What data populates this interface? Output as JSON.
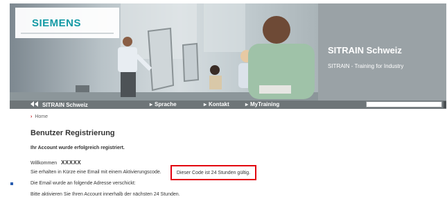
{
  "header": {
    "logo_text": "SIEMENS",
    "side_title": "SITRAIN Schweiz",
    "side_subtitle": "SITRAIN - Training for Industry"
  },
  "nav": {
    "brand": "SITRAIN Schweiz",
    "brand_icon": "double-chevron-icon",
    "items": [
      {
        "label": "Sprache",
        "icon": "triangle-right-icon"
      },
      {
        "label": "Kontakt",
        "icon": "triangle-right-icon"
      },
      {
        "label": "MyTraining",
        "icon": "triangle-right-icon"
      }
    ],
    "search": {
      "value": ""
    }
  },
  "breadcrumb": {
    "arrow": "›",
    "label": "Home"
  },
  "content": {
    "title": "Benutzer Registrierung",
    "success": "Ihr Account wurde erfolgreich registriert.",
    "welcome_label": "Willkommen",
    "welcome_value": "XXXXX",
    "line1": "Sie erhalten in Kürze eine Email mit einem Aktivierungscode.",
    "highlight": "Dieser Code ist 24 Stunden gültig.",
    "line2": "Die Email wurde an folgende Adresse verschickt:",
    "line3": "Bitte aktivieren Sie Ihren Account innerhalb der nächsten 24 Stunden."
  },
  "colors": {
    "logo": "#139aa5",
    "navbar": "#6e7578",
    "side_panel": "#9aa2a6",
    "highlight_border": "#e2000f",
    "breadcrumb_arrow": "#c0161c"
  }
}
